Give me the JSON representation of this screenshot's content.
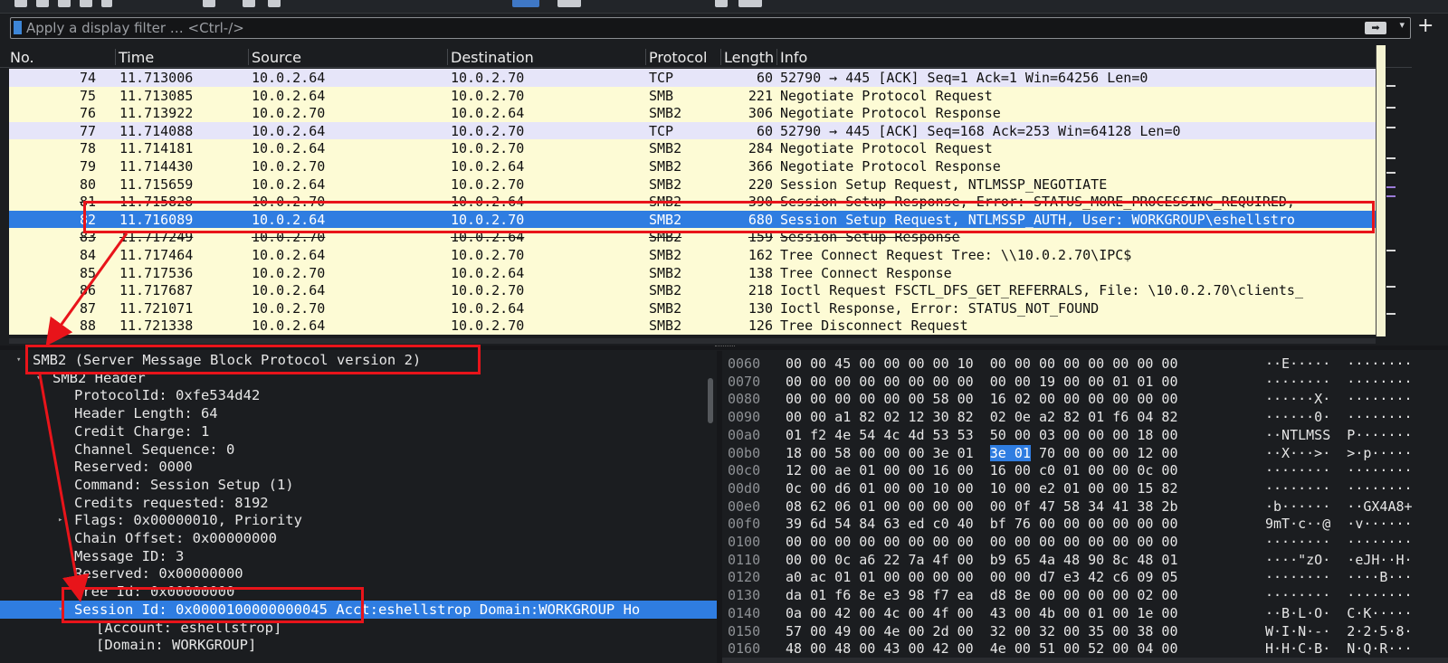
{
  "filter": {
    "placeholder": "Apply a display filter … <Ctrl-/>",
    "arrow_icon": "arrow-right-icon",
    "dropdown_icon": "chevron-down-icon",
    "plus_label": "+"
  },
  "columns": {
    "no": "No.",
    "time": "Time",
    "source": "Source",
    "destination": "Destination",
    "protocol": "Protocol",
    "length": "Length",
    "info": "Info"
  },
  "packets": [
    {
      "no": "74",
      "time": "11.713006",
      "src": "10.0.2.64",
      "dst": "10.0.2.70",
      "proto": "TCP",
      "len": "60",
      "info": "52790 → 445 [ACK] Seq=1 Ack=1 Win=64256 Len=0",
      "kind": "tcp"
    },
    {
      "no": "75",
      "time": "11.713085",
      "src": "10.0.2.64",
      "dst": "10.0.2.70",
      "proto": "SMB",
      "len": "221",
      "info": "Negotiate Protocol Request",
      "kind": "smb"
    },
    {
      "no": "76",
      "time": "11.713922",
      "src": "10.0.2.70",
      "dst": "10.0.2.64",
      "proto": "SMB2",
      "len": "306",
      "info": "Negotiate Protocol Response",
      "kind": "smb"
    },
    {
      "no": "77",
      "time": "11.714088",
      "src": "10.0.2.64",
      "dst": "10.0.2.70",
      "proto": "TCP",
      "len": "60",
      "info": "52790 → 445 [ACK] Seq=168 Ack=253 Win=64128 Len=0",
      "kind": "tcp"
    },
    {
      "no": "78",
      "time": "11.714181",
      "src": "10.0.2.64",
      "dst": "10.0.2.70",
      "proto": "SMB2",
      "len": "284",
      "info": "Negotiate Protocol Request",
      "kind": "smb"
    },
    {
      "no": "79",
      "time": "11.714430",
      "src": "10.0.2.70",
      "dst": "10.0.2.64",
      "proto": "SMB2",
      "len": "366",
      "info": "Negotiate Protocol Response",
      "kind": "smb"
    },
    {
      "no": "80",
      "time": "11.715659",
      "src": "10.0.2.64",
      "dst": "10.0.2.70",
      "proto": "SMB2",
      "len": "220",
      "info": "Session Setup Request, NTLMSSP_NEGOTIATE",
      "kind": "smb"
    },
    {
      "no": "81",
      "time": "11.715828",
      "src": "10.0.2.70",
      "dst": "10.0.2.64",
      "proto": "SMB2",
      "len": "390",
      "info": "Session Setup Response, Error: STATUS_MORE_PROCESSING_REQUIRED,",
      "kind": "smb strike"
    },
    {
      "no": "82",
      "time": "11.716089",
      "src": "10.0.2.64",
      "dst": "10.0.2.70",
      "proto": "SMB2",
      "len": "680",
      "info": "Session Setup Request, NTLMSSP_AUTH, User: WORKGROUP\\eshellstro",
      "kind": "sel"
    },
    {
      "no": "83",
      "time": "11.717249",
      "src": "10.0.2.70",
      "dst": "10.0.2.64",
      "proto": "SMB2",
      "len": "159",
      "info": "Session Setup Response",
      "kind": "smb strike"
    },
    {
      "no": "84",
      "time": "11.717464",
      "src": "10.0.2.64",
      "dst": "10.0.2.70",
      "proto": "SMB2",
      "len": "162",
      "info": "Tree Connect Request Tree: \\\\10.0.2.70\\IPC$",
      "kind": "smb"
    },
    {
      "no": "85",
      "time": "11.717536",
      "src": "10.0.2.70",
      "dst": "10.0.2.64",
      "proto": "SMB2",
      "len": "138",
      "info": "Tree Connect Response",
      "kind": "smb"
    },
    {
      "no": "86",
      "time": "11.717687",
      "src": "10.0.2.64",
      "dst": "10.0.2.70",
      "proto": "SMB2",
      "len": "218",
      "info": "Ioctl Request FSCTL_DFS_GET_REFERRALS, File: \\10.0.2.70\\clients_",
      "kind": "smb"
    },
    {
      "no": "87",
      "time": "11.721071",
      "src": "10.0.2.70",
      "dst": "10.0.2.64",
      "proto": "SMB2",
      "len": "130",
      "info": "Ioctl Response, Error: STATUS_NOT_FOUND",
      "kind": "smb"
    },
    {
      "no": "88",
      "time": "11.721338",
      "src": "10.0.2.64",
      "dst": "10.0.2.70",
      "proto": "SMB2",
      "len": "126",
      "info": "Tree Disconnect Request",
      "kind": "smb"
    }
  ],
  "detail": [
    {
      "text": "SMB2 (Server Message Block Protocol version 2)",
      "indent": 0,
      "expander": "open",
      "sel": false
    },
    {
      "text": "SMB2 Header",
      "indent": 1,
      "expander": "open",
      "sel": false
    },
    {
      "text": "ProtocolId: 0xfe534d42",
      "indent": 2,
      "expander": "",
      "sel": false
    },
    {
      "text": "Header Length: 64",
      "indent": 2,
      "expander": "",
      "sel": false
    },
    {
      "text": "Credit Charge: 1",
      "indent": 2,
      "expander": "",
      "sel": false
    },
    {
      "text": "Channel Sequence: 0",
      "indent": 2,
      "expander": "",
      "sel": false
    },
    {
      "text": "Reserved: 0000",
      "indent": 2,
      "expander": "",
      "sel": false
    },
    {
      "text": "Command: Session Setup (1)",
      "indent": 2,
      "expander": "",
      "sel": false
    },
    {
      "text": "Credits requested: 8192",
      "indent": 2,
      "expander": "",
      "sel": false
    },
    {
      "text": "Flags: 0x00000010, Priority",
      "indent": 2,
      "expander": "closed",
      "sel": false
    },
    {
      "text": "Chain Offset: 0x00000000",
      "indent": 2,
      "expander": "",
      "sel": false
    },
    {
      "text": "Message ID: 3",
      "indent": 2,
      "expander": "",
      "sel": false
    },
    {
      "text": "Reserved: 0x00000000",
      "indent": 2,
      "expander": "",
      "sel": false
    },
    {
      "text": "Tree Id: 0x00000000",
      "indent": 2,
      "expander": "",
      "sel": false
    },
    {
      "text": "Session Id: 0x0000100000000045 Acct:eshellstrop Domain:WORKGROUP Ho",
      "indent": 2,
      "expander": "open",
      "sel": true
    },
    {
      "text": "[Account: eshellstrop]",
      "indent": 3,
      "expander": "",
      "sel": false
    },
    {
      "text": "[Domain: WORKGROUP]",
      "indent": 3,
      "expander": "",
      "sel": false
    }
  ],
  "hex": [
    {
      "off": "0060",
      "pre": "00 00 45 00 00 00 00 10  00 00 00 00 00 00 00 00",
      "hl": "",
      "post": "",
      "asc": "··E·····  ········"
    },
    {
      "off": "0070",
      "pre": "00 00 00 00 00 00 00 00  00 00 19 00 00 01 01 00",
      "hl": "",
      "post": "",
      "asc": "········  ········"
    },
    {
      "off": "0080",
      "pre": "00 00 00 00 00 00 58 00  16 02 00 00 00 00 00 00",
      "hl": "",
      "post": "",
      "asc": "······X·  ········"
    },
    {
      "off": "0090",
      "pre": "00 00 a1 82 02 12 30 82  02 0e a2 82 01 f6 04 82",
      "hl": "",
      "post": "",
      "asc": "······0·  ········"
    },
    {
      "off": "00a0",
      "pre": "01 f2 4e 54 4c 4d 53 53  50 00 03 00 00 00 18 00",
      "hl": "",
      "post": "",
      "asc": "··NTLMSS  P·······"
    },
    {
      "off": "00b0",
      "pre": "18 00 58 00 00 00 3e 01  ",
      "hl": "3e 01",
      "post": " 70 00 00 00 12 00",
      "asc": "··X···>·  >·p·····"
    },
    {
      "off": "00c0",
      "pre": "12 00 ae 01 00 00 16 00  16 00 c0 01 00 00 0c 00",
      "hl": "",
      "post": "",
      "asc": "········  ········"
    },
    {
      "off": "00d0",
      "pre": "0c 00 d6 01 00 00 10 00  10 00 e2 01 00 00 15 82",
      "hl": "",
      "post": "",
      "asc": "········  ········"
    },
    {
      "off": "00e0",
      "pre": "08 62 06 01 00 00 00 00  00 0f 47 58 34 41 38 2b",
      "hl": "",
      "post": "",
      "asc": "·b······  ··GX4A8+"
    },
    {
      "off": "00f0",
      "pre": "39 6d 54 84 63 ed c0 40  bf 76 00 00 00 00 00 00",
      "hl": "",
      "post": "",
      "asc": "9mT·c··@  ·v······"
    },
    {
      "off": "0100",
      "pre": "00 00 00 00 00 00 00 00  00 00 00 00 00 00 00 00",
      "hl": "",
      "post": "",
      "asc": "········  ········"
    },
    {
      "off": "0110",
      "pre": "00 00 0c a6 22 7a 4f 00  b9 65 4a 48 90 8c 48 01",
      "hl": "",
      "post": "",
      "asc": "····\"zO·  ·eJH··H·"
    },
    {
      "off": "0120",
      "pre": "a0 ac 01 01 00 00 00 00  00 00 d7 e3 42 c6 09 05",
      "hl": "",
      "post": "",
      "asc": "········  ····B···"
    },
    {
      "off": "0130",
      "pre": "da 01 f6 8e e3 98 f7 ea  d8 8e 00 00 00 00 02 00",
      "hl": "",
      "post": "",
      "asc": "········  ········"
    },
    {
      "off": "0140",
      "pre": "0a 00 42 00 4c 00 4f 00  43 00 4b 00 01 00 1e 00",
      "hl": "",
      "post": "",
      "asc": "··B·L·O·  C·K·····"
    },
    {
      "off": "0150",
      "pre": "57 00 49 00 4e 00 2d 00  32 00 32 00 35 00 38 00",
      "hl": "",
      "post": "",
      "asc": "W·I·N·-·  2·2·5·8·"
    },
    {
      "off": "0160",
      "pre": "48 00 48 00 43 00 42 00  4e 00 51 00 52 00 04 00",
      "hl": "",
      "post": "",
      "asc": "H·H·C·B·  N·Q·R···"
    }
  ],
  "colors": {
    "accent": "#2f7de1",
    "tcp_row": "#e6e5f9",
    "smb_row": "#fdfbd5",
    "annotation": "#e8141a"
  }
}
